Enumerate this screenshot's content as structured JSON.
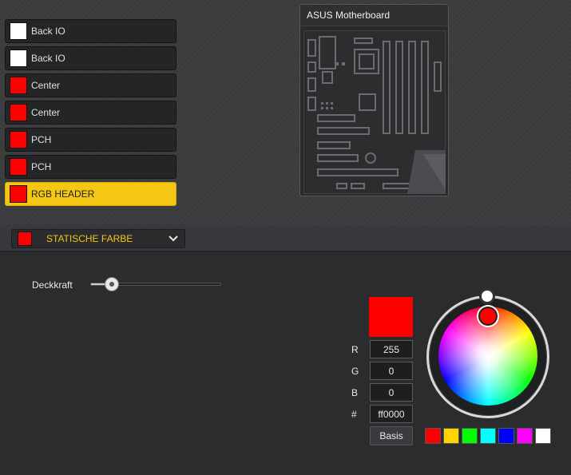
{
  "zones": [
    {
      "label": "Back IO",
      "color": "#ffffff"
    },
    {
      "label": "Back IO",
      "color": "#ffffff"
    },
    {
      "label": "Center",
      "color": "#ff0000"
    },
    {
      "label": "Center",
      "color": "#ff0000"
    },
    {
      "label": "PCH",
      "color": "#ff0000"
    },
    {
      "label": "PCH",
      "color": "#ff0000"
    },
    {
      "label": "RGB HEADER",
      "color": "#ff0000",
      "selected": true
    }
  ],
  "device": {
    "title": "ASUS Motherboard"
  },
  "effect": {
    "label": "STATISCHE FARBE",
    "color": "#ff0000",
    "icon": "chevron-down-icon"
  },
  "opacity": {
    "label": "Deckkraft",
    "value_fraction": 0.15
  },
  "color_picker": {
    "preview_color": "#ff0000",
    "r_label": "R",
    "r_value": "255",
    "g_label": "G",
    "g_value": "0",
    "b_label": "B",
    "b_value": "0",
    "hex_label": "#",
    "hex_value": "ff0000",
    "basis_label": "Basis",
    "presets": [
      "#ff0000",
      "#ffd500",
      "#00ff00",
      "#00ffff",
      "#0000ff",
      "#ff00ff",
      "#ffffff"
    ]
  },
  "colors": {
    "accent": "#f3c713"
  }
}
